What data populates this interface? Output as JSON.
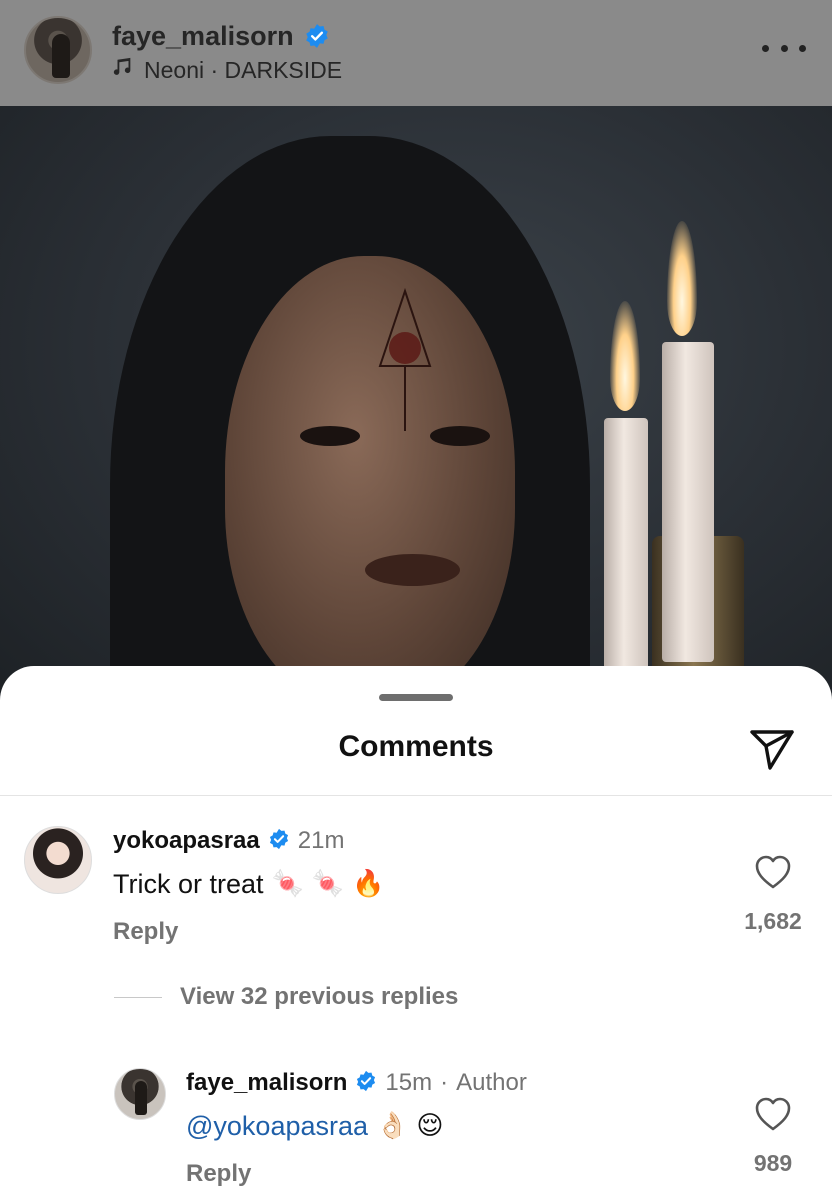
{
  "post": {
    "username": "faye_malisorn",
    "music": "Neoni · DARKSIDE",
    "more_icon": "more-horizontal-icon",
    "music_icon": "music-note-icon",
    "verified_icon": "verified-badge-icon"
  },
  "comments_sheet": {
    "title": "Comments",
    "share_icon": "paper-plane-icon",
    "view_replies": "View 32 previous replies",
    "items": [
      {
        "username": "yokoapasraa",
        "time": "21m",
        "text": "Trick or treat",
        "emojis": [
          "🍬",
          "🍬",
          "🔥"
        ],
        "reply_label": "Reply",
        "likes": "1,682"
      },
      {
        "username": "faye_malisorn",
        "time": "15m",
        "separator": "·",
        "author_label": "Author",
        "mention": "@yokoapasraa",
        "emojis": [
          "👌🏻",
          "😌"
        ],
        "reply_label": "Reply",
        "likes": "989"
      }
    ]
  },
  "colors": {
    "verified_blue": "#1d8cf0",
    "mention_blue": "#1f5fa8",
    "secondary_text": "#737373",
    "header_overlay": "#8a8a8a"
  }
}
